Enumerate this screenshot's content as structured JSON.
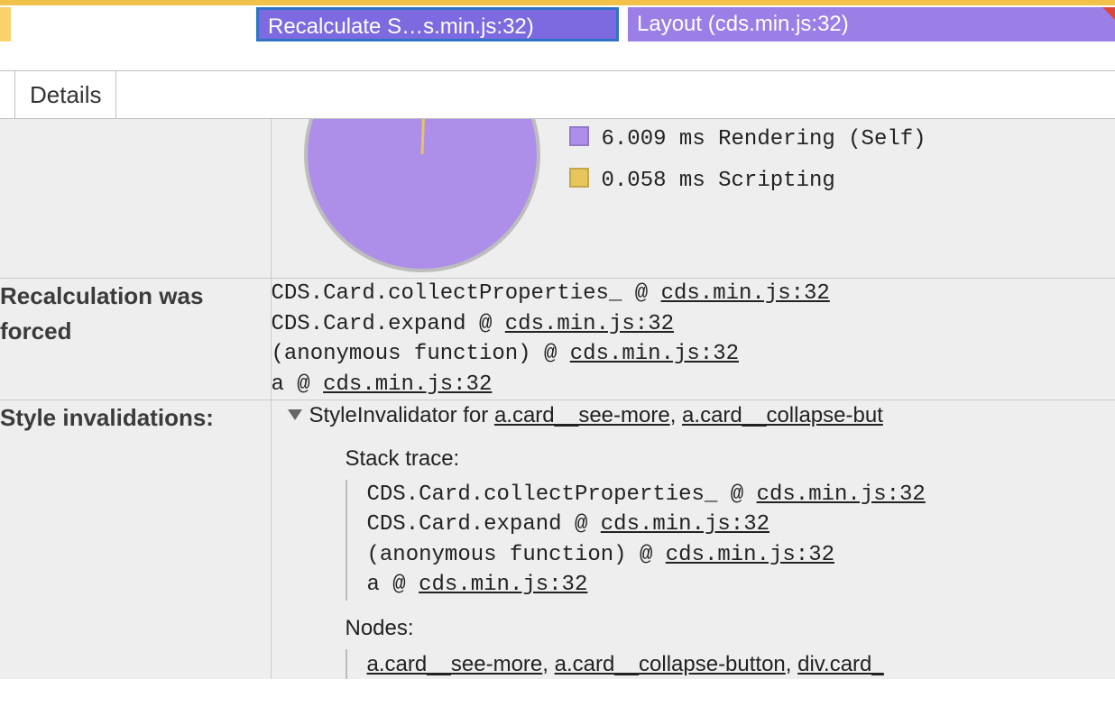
{
  "timeline": {
    "recalc_label": "Recalculate S…s.min.js:32)",
    "layout_label": "Layout (cds.min.js:32)"
  },
  "tab": {
    "details": "Details"
  },
  "chart_data": {
    "type": "pie",
    "series": [
      {
        "name": "Rendering (Self)",
        "value": 6.009,
        "unit": "ms",
        "color": "#ad8fea"
      },
      {
        "name": "Scripting",
        "value": 0.058,
        "unit": "ms",
        "color": "#e7c55a"
      }
    ]
  },
  "legend": {
    "rendering": "6.009 ms Rendering (Self)",
    "scripting": "0.058 ms Scripting"
  },
  "recalc_forced": {
    "label": "Recalculation was forced",
    "trace": [
      {
        "fn": "CDS.Card.collectProperties_",
        "at": " @ ",
        "loc": "cds.min.js:32"
      },
      {
        "fn": "CDS.Card.expand",
        "at": " @ ",
        "loc": "cds.min.js:32"
      },
      {
        "fn": "(anonymous function)",
        "at": " @ ",
        "loc": "cds.min.js:32"
      },
      {
        "fn": "a",
        "at": " @ ",
        "loc": "cds.min.js:32"
      }
    ]
  },
  "style_inval": {
    "label": "Style invalidations:",
    "header_prefix": "StyleInvalidator for ",
    "header_sel1": "a.card__see-more",
    "header_sep": ", ",
    "header_sel2": "a.card__collapse-but",
    "stack_label": "Stack trace:",
    "trace": [
      {
        "fn": "CDS.Card.collectProperties_",
        "at": " @ ",
        "loc": "cds.min.js:32"
      },
      {
        "fn": "CDS.Card.expand",
        "at": " @ ",
        "loc": "cds.min.js:32"
      },
      {
        "fn": "(anonymous function)",
        "at": " @ ",
        "loc": "cds.min.js:32"
      },
      {
        "fn": "a",
        "at": " @ ",
        "loc": "cds.min.js:32"
      }
    ],
    "nodes_label": "Nodes:",
    "nodes": [
      "a.card__see-more",
      "a.card__collapse-button",
      "div.card_"
    ],
    "nodes_sep": ", "
  }
}
